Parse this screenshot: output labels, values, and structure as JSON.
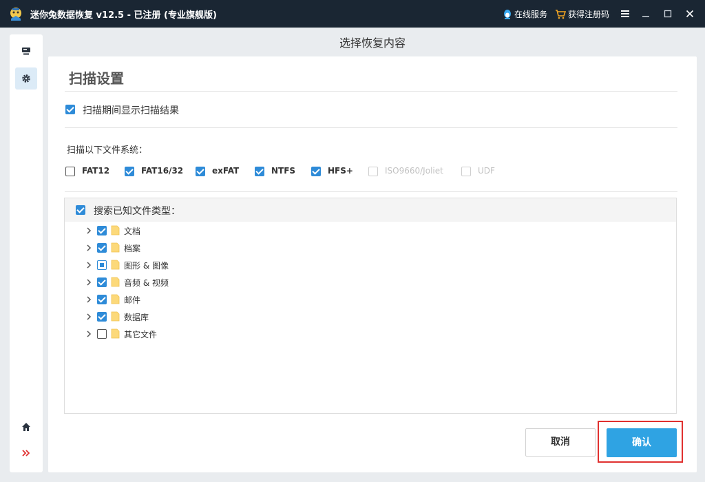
{
  "window": {
    "title": "迷你兔数据恢复 v12.5 - 已注册 (专业旗舰版)",
    "online_service": "在线服务",
    "get_code": "获得注册码"
  },
  "main": {
    "header": "选择恢复内容",
    "section_title": "扫描设置",
    "show_results": {
      "label": "扫描期间显示扫描结果",
      "checked": true
    },
    "fs_prompt": "扫描以下文件系统：",
    "filesystems": [
      {
        "label": "FAT12",
        "state": "unchecked"
      },
      {
        "label": "FAT16/32",
        "state": "checked"
      },
      {
        "label": "exFAT",
        "state": "checked"
      },
      {
        "label": "NTFS",
        "state": "checked"
      },
      {
        "label": "HFS+",
        "state": "checked"
      },
      {
        "label": "ISO9660/Joliet",
        "state": "disabled"
      },
      {
        "label": "UDF",
        "state": "disabled"
      }
    ],
    "known_types": {
      "label": "搜索已知文件类型：",
      "checked": true,
      "items": [
        {
          "label": "文档",
          "state": "checked"
        },
        {
          "label": "档案",
          "state": "checked"
        },
        {
          "label": "图形 & 图像",
          "state": "partial"
        },
        {
          "label": "音频 & 视频",
          "state": "checked"
        },
        {
          "label": "邮件",
          "state": "checked"
        },
        {
          "label": "数据库",
          "state": "checked"
        },
        {
          "label": "其它文件",
          "state": "unchecked"
        }
      ]
    },
    "buttons": {
      "cancel": "取消",
      "confirm": "确认"
    }
  },
  "colors": {
    "titlebar": "#1a2633",
    "accent": "#2e8bd8",
    "confirm": "#2fa3e3",
    "highlight": "#e0302f"
  }
}
